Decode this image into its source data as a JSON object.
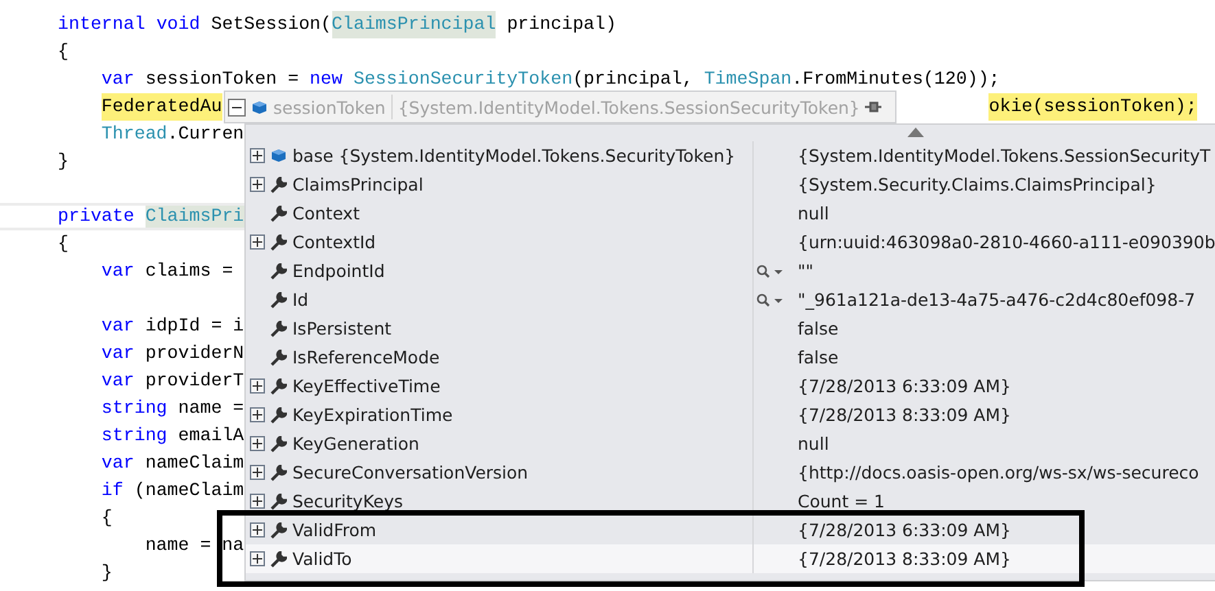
{
  "code_lines": [
    {
      "segments": [
        {
          "text": "internal",
          "kind": "keyword"
        },
        {
          "text": " void",
          "kind": "keyword"
        },
        {
          "text": " SetSession(",
          "kind": "plain"
        },
        {
          "text": "ClaimsPrincipal",
          "kind": "type",
          "reference": true
        },
        {
          "text": " principal)",
          "kind": "plain"
        }
      ]
    },
    {
      "segments": [
        {
          "text": "{",
          "kind": "plain"
        }
      ],
      "children": [
        {
          "segments": [
            {
              "text": "var",
              "kind": "keyword"
            },
            {
              "text": " sessionToken = ",
              "kind": "plain"
            },
            {
              "text": "new",
              "kind": "keyword"
            },
            {
              "text": " SessionSecurityToken",
              "kind": "type"
            },
            {
              "text": "(principal, ",
              "kind": "plain"
            },
            {
              "text": "TimeSpan",
              "kind": "type"
            },
            {
              "text": ".FromMinutes(120));",
              "kind": "plain"
            }
          ]
        },
        {
          "current_statement": true,
          "segments": [
            {
              "text": "FederatedAu",
              "kind": "plain"
            },
            {
              "text": "okie(sessionToken);",
              "kind": "plain",
              "covered_before": true
            }
          ]
        },
        {
          "segments": [
            {
              "text": "Thread",
              "kind": "type"
            },
            {
              "text": ".Curren",
              "kind": "plain"
            }
          ]
        }
      ]
    },
    {
      "blank_line_after": true,
      "segments": [
        {
          "text": "}",
          "kind": "plain"
        }
      ]
    },
    {
      "caret_line": true,
      "segments": [
        {
          "text": "private ",
          "kind": "keyword"
        },
        {
          "text": "ClaimsPri",
          "kind": "type",
          "reference": true
        }
      ]
    },
    {
      "segments": [
        {
          "text": "{",
          "kind": "plain"
        }
      ],
      "children": [
        {
          "blank_line_after": true,
          "segments": [
            {
              "text": "var",
              "kind": "keyword"
            },
            {
              "text": " claims =",
              "kind": "plain"
            }
          ]
        },
        {
          "segments": [
            {
              "text": "var",
              "kind": "keyword"
            },
            {
              "text": " idpId = i",
              "kind": "plain"
            }
          ]
        },
        {
          "segments": [
            {
              "text": "var",
              "kind": "keyword"
            },
            {
              "text": " providerN",
              "kind": "plain"
            }
          ]
        },
        {
          "segments": [
            {
              "text": "var",
              "kind": "keyword"
            },
            {
              "text": " providerT",
              "kind": "plain"
            }
          ]
        },
        {
          "segments": [
            {
              "text": "string",
              "kind": "keyword"
            },
            {
              "text": " name =",
              "kind": "plain"
            }
          ]
        },
        {
          "segments": [
            {
              "text": "string",
              "kind": "keyword"
            },
            {
              "text": " emailA",
              "kind": "plain"
            }
          ]
        },
        {
          "segments": [
            {
              "text": "var",
              "kind": "keyword"
            },
            {
              "text": " nameClaim",
              "kind": "plain"
            }
          ]
        },
        {
          "segments": [
            {
              "text": "if",
              "kind": "keyword"
            },
            {
              "text": " (nameClaim",
              "kind": "plain"
            }
          ]
        },
        {
          "segments": [
            {
              "text": "{",
              "kind": "plain"
            }
          ],
          "children": [
            {
              "segments": [
                {
                  "text": "name = na",
                  "kind": "plain"
                }
              ]
            }
          ]
        },
        {
          "segments": [
            {
              "text": "}",
              "kind": "plain"
            }
          ]
        }
      ]
    }
  ],
  "datatip": {
    "expanded": true,
    "name": "sessionToken",
    "type": "{System.IdentityModel.Tokens.SessionSecurityToken}",
    "rows": [
      {
        "name": "base {System.IdentityModel.Tokens.SecurityToken}",
        "value": "{System.IdentityModel.Tokens.SessionSecurityT",
        "kind": "field",
        "expandable": true,
        "visualizer": false,
        "highlighted": false
      },
      {
        "name": "ClaimsPrincipal",
        "value": "{System.Security.Claims.ClaimsPrincipal}",
        "kind": "property",
        "expandable": true,
        "visualizer": false,
        "highlighted": false
      },
      {
        "name": "Context",
        "value": "null",
        "kind": "property",
        "expandable": false,
        "visualizer": false,
        "highlighted": false
      },
      {
        "name": "ContextId",
        "value": "{urn:uuid:463098a0-2810-4660-a111-e090390b",
        "kind": "property",
        "expandable": true,
        "visualizer": false,
        "highlighted": false
      },
      {
        "name": "EndpointId",
        "value": "\"\"",
        "kind": "property",
        "expandable": false,
        "visualizer": true,
        "highlighted": false
      },
      {
        "name": "Id",
        "value": "\"_961a121a-de13-4a75-a476-c2d4c80ef098-7",
        "kind": "property",
        "expandable": false,
        "visualizer": true,
        "highlighted": false
      },
      {
        "name": "IsPersistent",
        "value": "false",
        "kind": "property",
        "expandable": false,
        "visualizer": false,
        "highlighted": false
      },
      {
        "name": "IsReferenceMode",
        "value": "false",
        "kind": "property",
        "expandable": false,
        "visualizer": false,
        "highlighted": false
      },
      {
        "name": "KeyEffectiveTime",
        "value": "{7/28/2013 6:33:09 AM}",
        "kind": "property",
        "expandable": true,
        "visualizer": false,
        "highlighted": false
      },
      {
        "name": "KeyExpirationTime",
        "value": "{7/28/2013 8:33:09 AM}",
        "kind": "property",
        "expandable": true,
        "visualizer": false,
        "highlighted": false
      },
      {
        "name": "KeyGeneration",
        "value": "null",
        "kind": "property",
        "expandable": true,
        "visualizer": false,
        "highlighted": false
      },
      {
        "name": "SecureConversationVersion",
        "value": "{http://docs.oasis-open.org/ws-sx/ws-secureco",
        "kind": "property",
        "expandable": true,
        "visualizer": false,
        "highlighted": false
      },
      {
        "name": "SecurityKeys",
        "value": "Count = 1",
        "kind": "property",
        "expandable": true,
        "visualizer": false,
        "highlighted": false
      },
      {
        "name": "ValidFrom",
        "value": "{7/28/2013 6:33:09 AM}",
        "kind": "property",
        "expandable": true,
        "visualizer": false,
        "highlighted": false
      },
      {
        "name": "ValidTo",
        "value": "{7/28/2013 8:33:09 AM}",
        "kind": "property",
        "expandable": true,
        "visualizer": false,
        "highlighted": true
      }
    ]
  }
}
